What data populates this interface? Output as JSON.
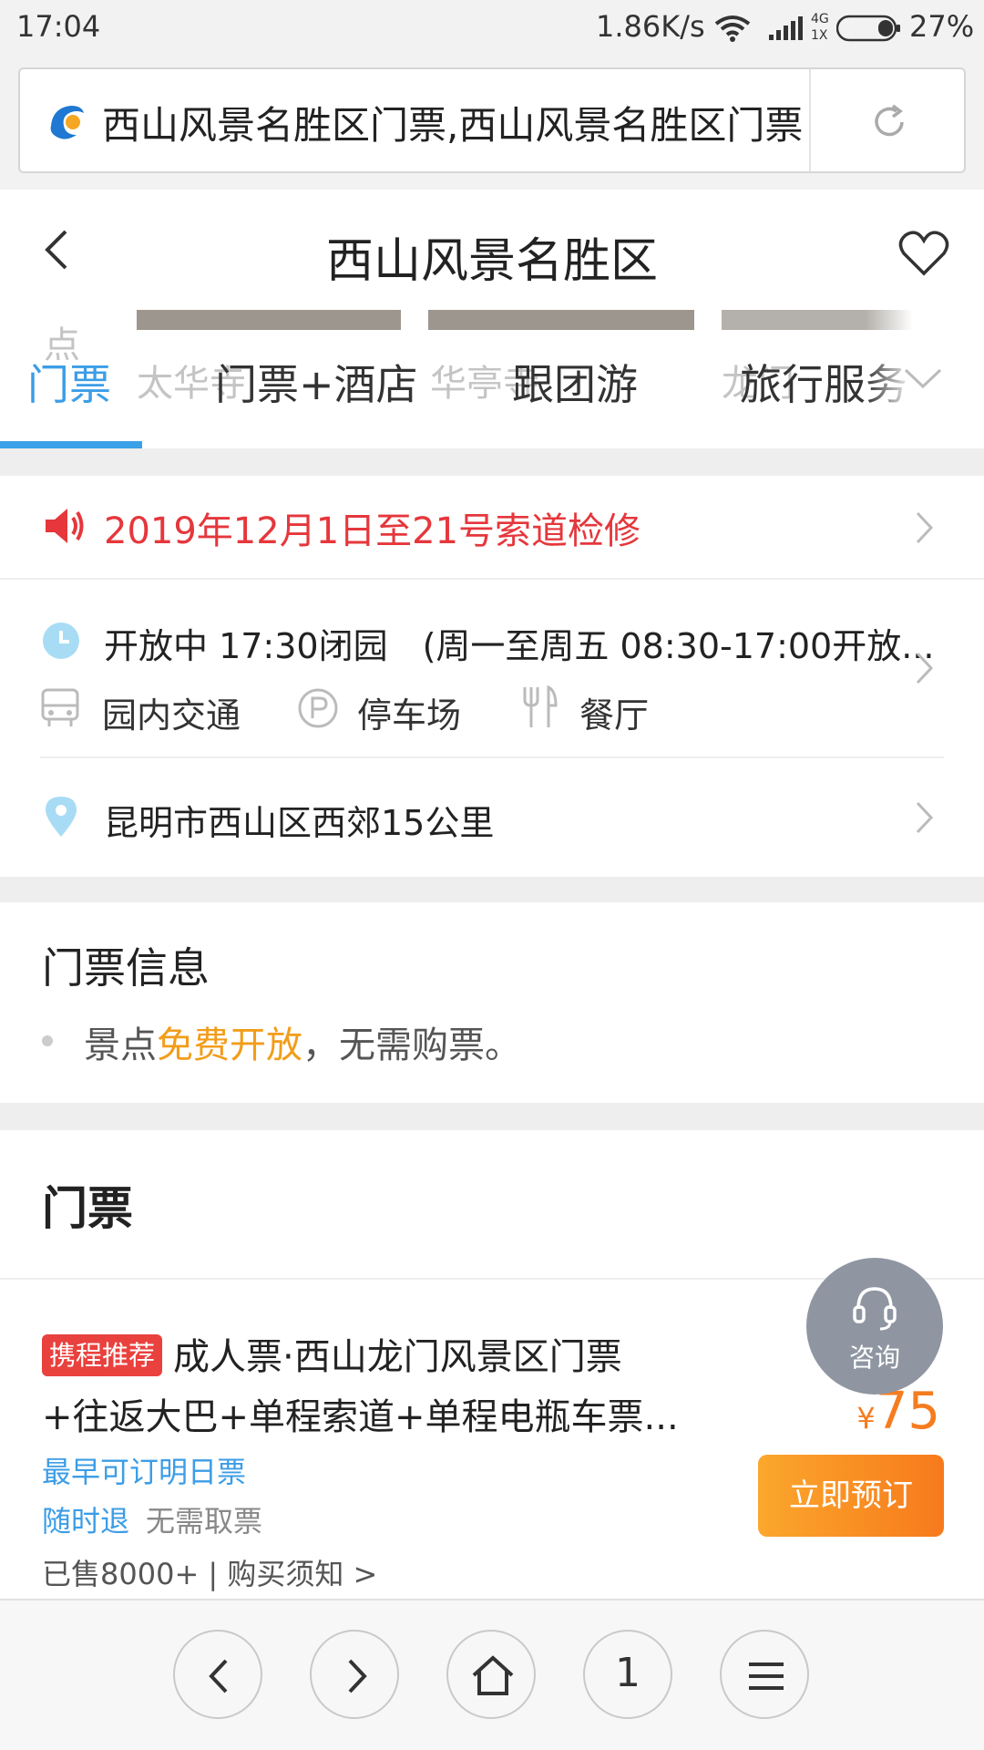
{
  "status_bar": {
    "time": "17:04",
    "net_speed": "1.86K/s",
    "net_4g": "4G",
    "net_1x": "1X",
    "battery": "27%"
  },
  "browser": {
    "address_text": "西山风景名胜区门票,西山风景名胜区门票价格",
    "tab_count": "1"
  },
  "header": {
    "title": "西山风景名胜区"
  },
  "tabs": {
    "items": [
      {
        "label": "门票",
        "active": true
      },
      {
        "label": "门票+酒店",
        "active": false
      },
      {
        "label": "跟团游",
        "active": false
      },
      {
        "label": "旅行服务",
        "active": false
      }
    ],
    "ghost_labels": [
      "点",
      "太华寺",
      "华亭寺",
      "龙门"
    ]
  },
  "notice": {
    "text": "2019年12月1日至21号索道检修"
  },
  "info": {
    "hours": "开放中 17:30闭园　(周一至周五 08:30-17:00开放...",
    "amenities": [
      "园内交通",
      "停车场",
      "餐厅"
    ],
    "address": "昆明市西山区西郊15公里"
  },
  "ticket_info": {
    "title": "门票信息",
    "line_prefix": "景点",
    "line_highlight": "免费开放",
    "line_suffix": "，无需购票。"
  },
  "tickets": {
    "title": "门票",
    "items": [
      {
        "badge": "携程推荐",
        "name_line1": "成人票·西山龙门风景区门票",
        "name_line2": "+往返大巴+单程索道+单程电瓶车票...",
        "earliest": "最早可订明日票",
        "refund": "随时退",
        "pickup": "无需取票",
        "sold": "已售8000+ | 购买须知 >",
        "currency": "¥",
        "price": "75",
        "button": "立即预订"
      }
    ]
  },
  "consult": {
    "label": "咨询"
  },
  "colors": {
    "accent_blue": "#3c9de6",
    "notice_red": "#e5373c",
    "highlight_orange": "#f29d1a",
    "price_orange": "#f57c1f"
  },
  "icons": [
    "ctrip-logo-icon",
    "refresh-icon",
    "back-icon",
    "heart-icon",
    "chevron-down-icon",
    "speaker-icon",
    "clock-icon",
    "bus-icon",
    "parking-icon",
    "restaurant-icon",
    "location-pin-icon",
    "headset-icon",
    "chevron-right-icon",
    "home-icon",
    "menu-icon"
  ]
}
